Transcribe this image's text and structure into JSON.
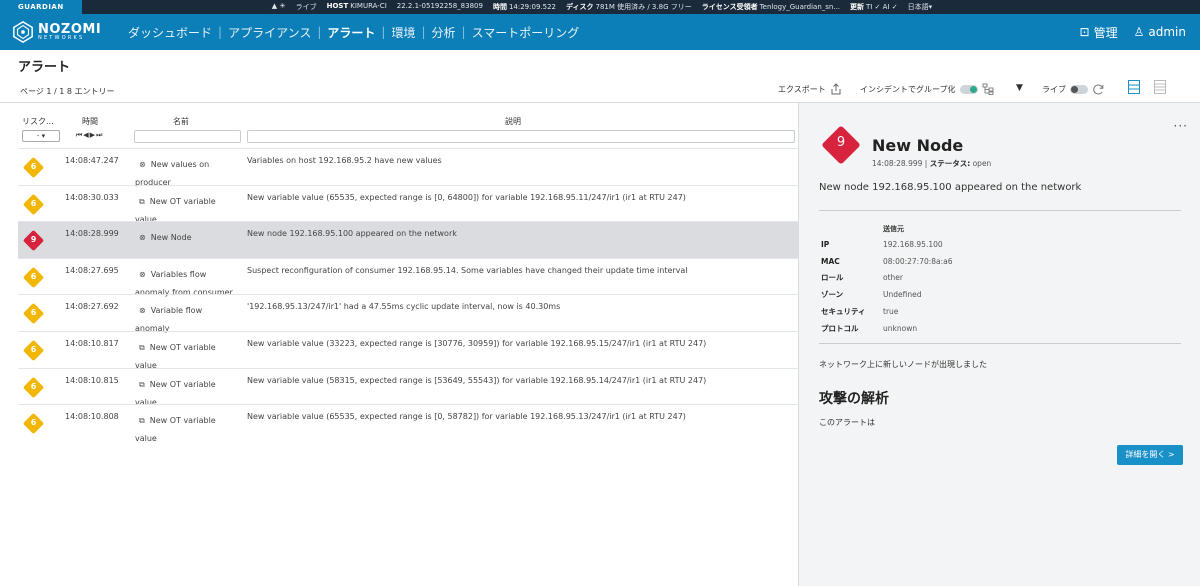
{
  "statusbar": {
    "brand": "GUARDIAN",
    "icons": "▲ ☀",
    "live": "ライブ",
    "host_label": "HOST",
    "host_value": "KIMURA-CI",
    "version": "22.2.1-05192258_83809",
    "time_label": "時間",
    "time_value": "14:29:09.522",
    "disk_label": "ディスク",
    "disk_value": "781M 使用済み / 3.8G フリー",
    "license_label": "ライセンス受領者",
    "license_value": "Tenlogy_Guardian_sn...",
    "update_label": "更新",
    "update_value": "TI ✓ AI ✓",
    "lang": "日本語▾"
  },
  "nav": {
    "logo_main": "NOZOMI",
    "logo_sub": "NETWORKS",
    "links": [
      "ダッシュボード",
      "アプライアンス",
      "アラート",
      "環境",
      "分析",
      "スマートポーリング"
    ],
    "manage": "管理",
    "user": "admin"
  },
  "page": {
    "title": "アラート",
    "pageinfo": "ページ 1 / 1 8 エントリー",
    "export": "エクスポート",
    "group_incident": "インシデントでグループ化",
    "live": "ライブ"
  },
  "table": {
    "headers": {
      "risk": "リスク...",
      "time": "時間",
      "name": "名前",
      "desc": "説明"
    },
    "risk_select": "- ▾",
    "time_nav": "⏮◀▶⏭",
    "rows": [
      {
        "risk": "6",
        "time": "14:08:47.247",
        "icon": "⊗",
        "name": "New values on producer",
        "desc": "Variables on host 192.168.95.2 have new values"
      },
      {
        "risk": "6",
        "time": "14:08:30.033",
        "icon": "⧉",
        "name": "New OT variable value",
        "desc": "New variable value (65535, expected range is [0, 64800]) for variable 192.168.95.11/247/ir1 (ir1 at RTU 247)"
      },
      {
        "risk": "9",
        "time": "14:08:28.999",
        "icon": "⊗",
        "name": "New Node",
        "desc": "New node 192.168.95.100 appeared on the network"
      },
      {
        "risk": "6",
        "time": "14:08:27.695",
        "icon": "⊗",
        "name": "Variables flow anomaly from consumer",
        "desc": "Suspect reconfiguration of consumer 192.168.95.14. Some variables have changed their update time interval"
      },
      {
        "risk": "6",
        "time": "14:08:27.692",
        "icon": "⊗",
        "name": "Variable flow anomaly",
        "desc": "'192.168.95.13/247/ir1' had a 47.55ms cyclic update interval, now is 40.30ms"
      },
      {
        "risk": "6",
        "time": "14:08:10.817",
        "icon": "⧉",
        "name": "New OT variable value",
        "desc": "New variable value (33223, expected range is [30776, 30959]) for variable 192.168.95.15/247/ir1 (ir1 at RTU 247)"
      },
      {
        "risk": "6",
        "time": "14:08:10.815",
        "icon": "⧉",
        "name": "New OT variable value",
        "desc": "New variable value (58315, expected range is [53649, 55543]) for variable 192.168.95.14/247/ir1 (ir1 at RTU 247)"
      },
      {
        "risk": "6",
        "time": "14:08:10.808",
        "icon": "⧉",
        "name": "New OT variable value",
        "desc": "New variable value (65535, expected range is [0, 58782]) for variable 192.168.95.13/247/ir1 (ir1 at RTU 247)"
      }
    ]
  },
  "detail": {
    "more": "···",
    "risk": "9",
    "title": "New Node",
    "time": "14:08:28.999",
    "status_label": "ステータス:",
    "status_value": "open",
    "description": "New node 192.168.95.100 appeared on the network",
    "source_header": "送信元",
    "props": [
      {
        "k": "IP",
        "v": "192.168.95.100"
      },
      {
        "k": "MAC",
        "v": "08:00:27:70:8a:a6"
      },
      {
        "k": "ロール",
        "v": "other"
      },
      {
        "k": "ゾーン",
        "v": "Undefined"
      },
      {
        "k": "セキュリティ",
        "v": "true"
      },
      {
        "k": "プロトコル",
        "v": "unknown"
      }
    ],
    "jp_desc": "ネットワーク上に新しいノードが出現しました",
    "attack_title": "攻撃の解析",
    "this_alert": "このアラートは",
    "detail_button": "詳細を開く >"
  },
  "colors": {
    "nav": "#0d7fb8",
    "risk6": "#f2b705",
    "risk9": "#d8233e",
    "toggle_on": "#2fa98e"
  }
}
